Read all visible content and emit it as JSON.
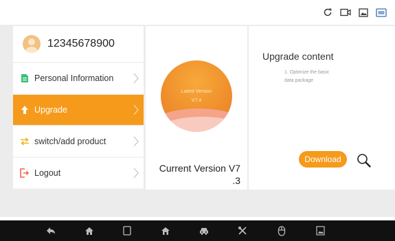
{
  "user": {
    "phone": "12345678900"
  },
  "menu": {
    "items": [
      {
        "label": "Personal Information",
        "icon": "document-icon"
      },
      {
        "label": "Upgrade",
        "icon": "arrow-up-icon",
        "active": true
      },
      {
        "label": "switch/add product",
        "icon": "switch-arrows-icon"
      },
      {
        "label": "Logout",
        "icon": "logout-icon"
      }
    ]
  },
  "version": {
    "badge_line1": "Latest Version",
    "badge_line2": "V7.4",
    "current_line1": "Current Version V7",
    "current_line2": ".3"
  },
  "upgrade": {
    "title": "Upgrade content",
    "desc_line1": "1. Optimize the basic",
    "desc_line2": "data package",
    "download_label": "Download"
  },
  "status_icons": [
    "refresh-icon",
    "video-record-icon",
    "screenshot-icon",
    "vci-icon"
  ],
  "nav_icons": [
    "back-icon",
    "home-icon",
    "recent-apps-icon",
    "house-icon",
    "car-icon",
    "tools-icon",
    "mouse-icon",
    "gallery-icon"
  ],
  "colors": {
    "accent": "#f59a1b",
    "navbar": "#111111",
    "panel_bg": "#ececec"
  }
}
